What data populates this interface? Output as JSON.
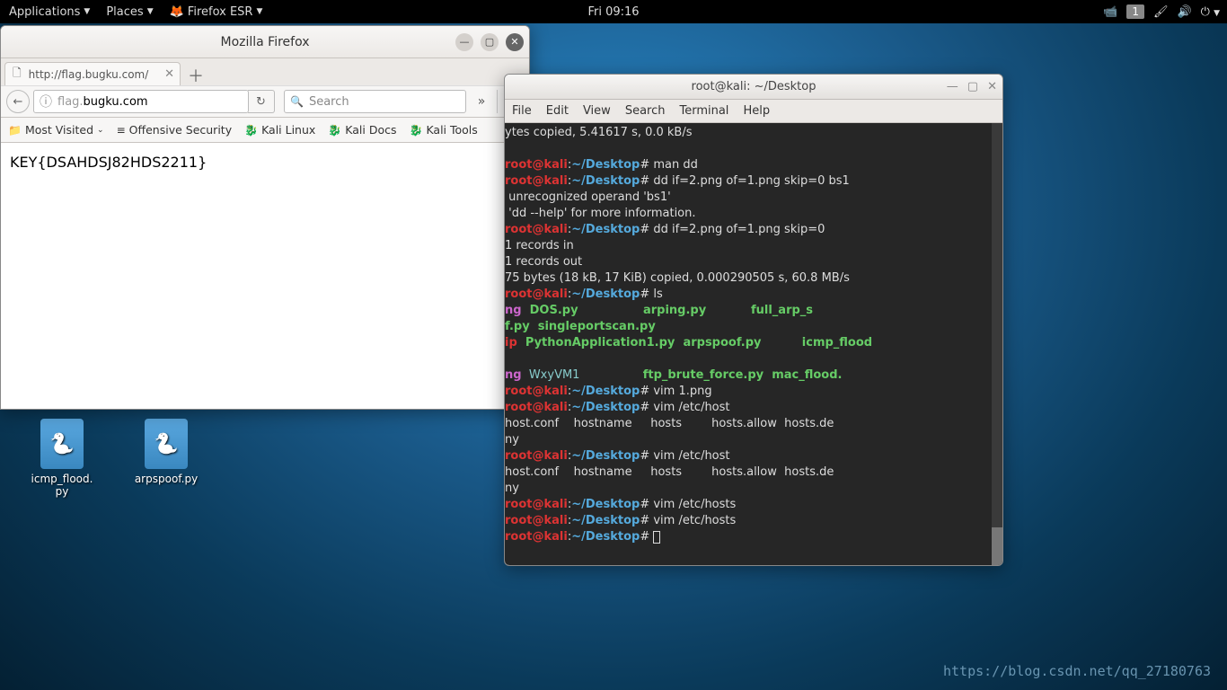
{
  "topbar": {
    "apps": "Applications",
    "places": "Places",
    "app_current": "Firefox ESR",
    "clock": "Fri 09:16",
    "workspace": "1"
  },
  "desktop_icons": [
    {
      "label": "icmp_flood.\npy"
    },
    {
      "label": "arpspoof.py"
    }
  ],
  "firefox": {
    "window_title": "Mozilla Firefox",
    "tab_label": "http://flag.bugku.com/",
    "url_prefix": "flag.",
    "url_host": "bugku.com",
    "search_placeholder": "Search",
    "bookmarks": [
      "Most Visited",
      "Offensive Security",
      "Kali Linux",
      "Kali Docs",
      "Kali Tools"
    ],
    "page_text": "KEY{DSAHDSJ82HDS2211}"
  },
  "terminal": {
    "title": "root@kali: ~/Desktop",
    "menus": [
      "File",
      "Edit",
      "View",
      "Search",
      "Terminal",
      "Help"
    ],
    "prompt_user": "root@kali",
    "prompt_sep": ":",
    "prompt_path": "~/Desktop",
    "prompt_end": "# ",
    "lines": {
      "l0": "ytes copied, 5.41617 s, 0.0 kB/s",
      "cmd1": "man dd",
      "cmd2": "dd if=2.png of=1.png skip=0 bs1",
      "l3": " unrecognized operand 'bs1'",
      "l4": " 'dd --help' for more information.",
      "cmd3": "dd if=2.png of=1.png skip=0",
      "l6": "1 records in",
      "l7": "1 records out",
      "l8": "75 bytes (18 kB, 17 KiB) copied, 0.000290505 s, 60.8 MB/s",
      "cmd4": "ls",
      "ls1a": "ng",
      "ls1b": "  DOS.py                ",
      "ls1c": "arping.py           ",
      "ls1d": "full_arp_s",
      "ls2a": "f.py  singleportscan.py",
      "ls3a": "ip",
      "ls3b": "  PythonApplication1.py  ",
      "ls3c": "arpspoof.py          ",
      "ls3d": "icmp_flood",
      "ls4a": "ng",
      "ls4b": "  WxyVM1                 ",
      "ls4c": "ftp_brute_force.py  ",
      "ls4d": "mac_flood.",
      "cmd5": "vim 1.png",
      "cmd6": "vim /etc/host",
      "comp1": "host.conf    hostname     hosts        hosts.allow  hosts.de",
      "ny": "ny",
      "cmd7": "vim /etc/host",
      "cmd8": "vim /etc/hosts",
      "cmd9": "vim /etc/hosts"
    }
  },
  "watermark": "https://blog.csdn.net/qq_27180763"
}
